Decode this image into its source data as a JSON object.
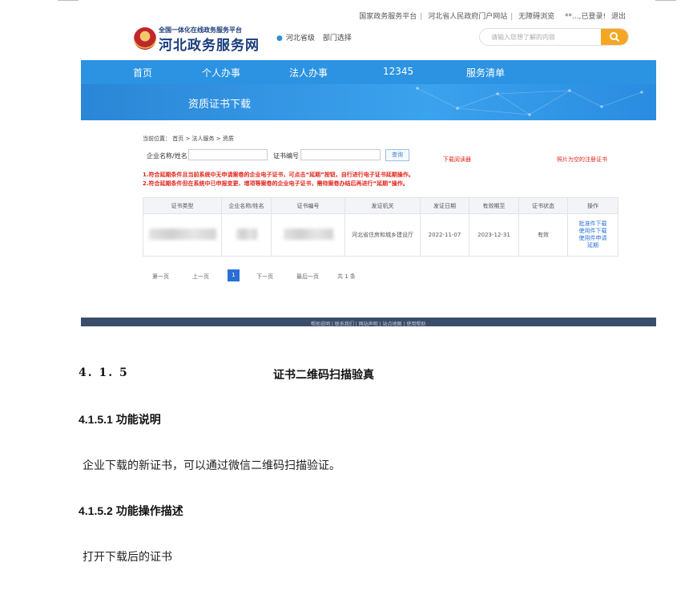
{
  "screenshot": {
    "top_links": [
      "国家政务服务平台",
      "河北省人民政府门户网站",
      "无障碍浏览",
      "**...,已登录!",
      "退出"
    ],
    "logo": {
      "subtitle": "全国一体化在线政务服务平台",
      "title": "河北政务服务网"
    },
    "location": {
      "region": "河北省级",
      "dept": "部门选择"
    },
    "search": {
      "placeholder": "请输入您想了解的内容"
    },
    "nav": [
      "首页",
      "个人办事",
      "法人办事",
      "12345",
      "服务清单"
    ],
    "banner_title": "资质证书下载",
    "breadcrumb": "当前位置： 首页 > 法人服务 > 资质",
    "form": {
      "name_label": "企业名称/姓名",
      "cert_label": "证书编号",
      "query_button": "查询"
    },
    "links": {
      "download_guide": "下载阅读器",
      "photo_empty": "照片为空的注册证书"
    },
    "notices": [
      "1.符合延期条件且当前系统中无申请案卷的企业电子证书，可点击“延期”按钮，自行进行电子证书延期操作。",
      "2.符合延期条件但在系统中已申报变更、增项等案卷的企业电子证书，需待案卷办结后再进行“延期”操作。"
    ],
    "table": {
      "headers": [
        "证书类型",
        "企业名称/姓名",
        "证书编号",
        "发证机关",
        "发证日期",
        "有效期至",
        "证书状态",
        "操作"
      ],
      "rows": [
        {
          "issuer": "河北省住房和城乡建设厅",
          "issue_date": "2022-11-07",
          "valid_until": "2023-12-31",
          "status": "有效",
          "actions": [
            "批准件下载",
            "使用件下载",
            "使用件申请延期"
          ]
        }
      ]
    },
    "pager": {
      "first": "第一页",
      "prev": "上一页",
      "current": "1",
      "next": "下一页",
      "last": "最后一页",
      "total": "共 1 条"
    },
    "footer": "帮助说明 | 联系我们 | 网站声明 | 站点地图 | 使用帮助"
  },
  "document": {
    "section_number": "4. 1. 5",
    "section_title": "证书二维码扫描验真",
    "sub1_title": "4.1.5.1 功能说明",
    "sub1_text": "企业下载的新证书，可以通过微信二维码扫描验证。",
    "sub2_title": "4.1.5.2 功能操作描述",
    "sub2_text": "打开下载后的证书"
  },
  "colors": {
    "nav": "#2b93e2",
    "accent": "#f5a623",
    "red_text": "#e0261c",
    "link": "#2b6fd6"
  }
}
